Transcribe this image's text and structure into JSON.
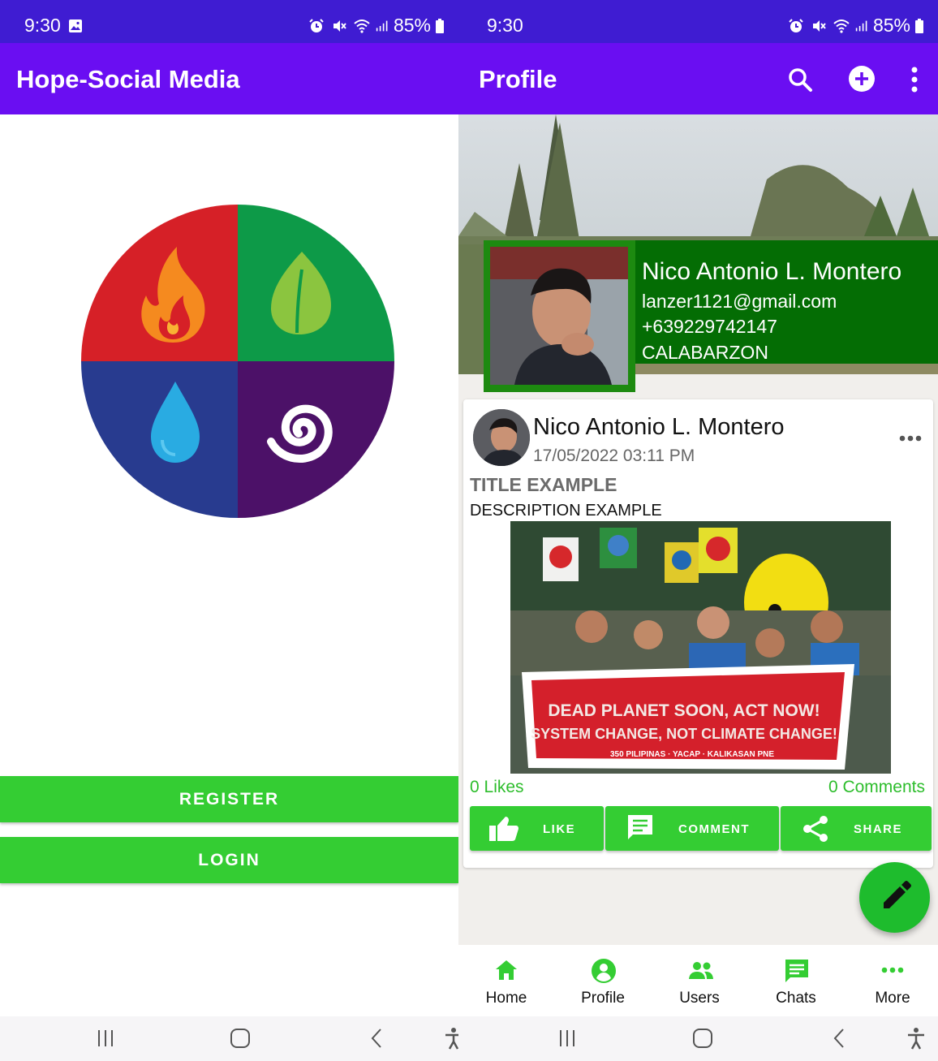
{
  "left": {
    "status": {
      "time": "9:30",
      "battery": "85%"
    },
    "appbar": {
      "title": "Hope-Social Media"
    },
    "logo": {
      "colors": {
        "fire": "#d62027",
        "leaf": "#0d9a48",
        "water": "#283b8f",
        "air": "#4c1168"
      }
    },
    "buttons": {
      "register": "REGISTER",
      "login": "LOGIN"
    }
  },
  "right": {
    "status": {
      "time": "9:30",
      "battery": "85%"
    },
    "appbar": {
      "title": "Profile",
      "icons": [
        "search-icon",
        "add-circle-icon",
        "more-vert-icon"
      ]
    },
    "profile": {
      "name": "Nico Antonio L. Montero",
      "email": "lanzer1121@gmail.com",
      "phone": "+639229742147",
      "region": "CALABARZON"
    },
    "post": {
      "author": "Nico Antonio L. Montero",
      "date": "17/05/2022 03:11 PM",
      "title": "TITLE EXAMPLE",
      "description": "DESCRIPTION EXAMPLE",
      "banner_line1": "DEAD PLANET SOON, ACT NOW!",
      "banner_line2": "SYSTEM CHANGE, NOT CLIMATE CHANGE!",
      "banner_footer": "350 PILIPINAS · YACAP · KALIKASAN PNE",
      "likes": "0 Likes",
      "comments": "0 Comments",
      "actions": {
        "like": "LIKE",
        "comment": "COMMENT",
        "share": "SHARE"
      }
    },
    "bottom_nav": [
      {
        "label": "Home",
        "icon": "home-icon"
      },
      {
        "label": "Profile",
        "icon": "account-circle-icon"
      },
      {
        "label": "Users",
        "icon": "users-icon"
      },
      {
        "label": "Chats",
        "icon": "chat-icon"
      },
      {
        "label": "More",
        "icon": "more-horiz-icon"
      }
    ],
    "accent": "#34cd33"
  }
}
